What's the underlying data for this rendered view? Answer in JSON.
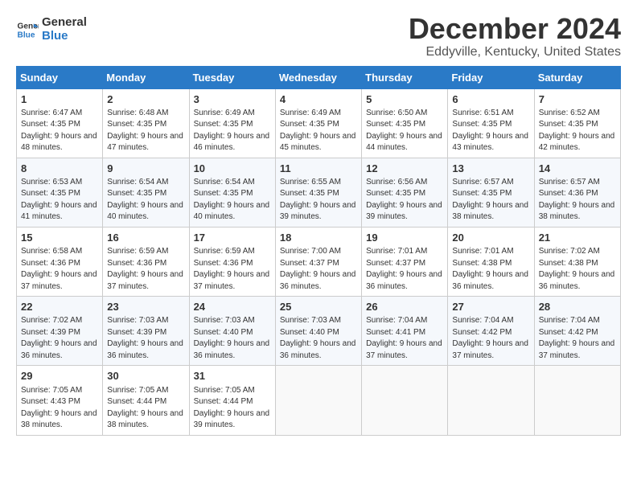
{
  "header": {
    "logo_line1": "General",
    "logo_line2": "Blue",
    "month": "December 2024",
    "location": "Eddyville, Kentucky, United States"
  },
  "weekdays": [
    "Sunday",
    "Monday",
    "Tuesday",
    "Wednesday",
    "Thursday",
    "Friday",
    "Saturday"
  ],
  "weeks": [
    [
      {
        "day": "1",
        "sunrise": "6:47 AM",
        "sunset": "4:35 PM",
        "daylight": "9 hours and 48 minutes."
      },
      {
        "day": "2",
        "sunrise": "6:48 AM",
        "sunset": "4:35 PM",
        "daylight": "9 hours and 47 minutes."
      },
      {
        "day": "3",
        "sunrise": "6:49 AM",
        "sunset": "4:35 PM",
        "daylight": "9 hours and 46 minutes."
      },
      {
        "day": "4",
        "sunrise": "6:49 AM",
        "sunset": "4:35 PM",
        "daylight": "9 hours and 45 minutes."
      },
      {
        "day": "5",
        "sunrise": "6:50 AM",
        "sunset": "4:35 PM",
        "daylight": "9 hours and 44 minutes."
      },
      {
        "day": "6",
        "sunrise": "6:51 AM",
        "sunset": "4:35 PM",
        "daylight": "9 hours and 43 minutes."
      },
      {
        "day": "7",
        "sunrise": "6:52 AM",
        "sunset": "4:35 PM",
        "daylight": "9 hours and 42 minutes."
      }
    ],
    [
      {
        "day": "8",
        "sunrise": "6:53 AM",
        "sunset": "4:35 PM",
        "daylight": "9 hours and 41 minutes."
      },
      {
        "day": "9",
        "sunrise": "6:54 AM",
        "sunset": "4:35 PM",
        "daylight": "9 hours and 40 minutes."
      },
      {
        "day": "10",
        "sunrise": "6:54 AM",
        "sunset": "4:35 PM",
        "daylight": "9 hours and 40 minutes."
      },
      {
        "day": "11",
        "sunrise": "6:55 AM",
        "sunset": "4:35 PM",
        "daylight": "9 hours and 39 minutes."
      },
      {
        "day": "12",
        "sunrise": "6:56 AM",
        "sunset": "4:35 PM",
        "daylight": "9 hours and 39 minutes."
      },
      {
        "day": "13",
        "sunrise": "6:57 AM",
        "sunset": "4:35 PM",
        "daylight": "9 hours and 38 minutes."
      },
      {
        "day": "14",
        "sunrise": "6:57 AM",
        "sunset": "4:36 PM",
        "daylight": "9 hours and 38 minutes."
      }
    ],
    [
      {
        "day": "15",
        "sunrise": "6:58 AM",
        "sunset": "4:36 PM",
        "daylight": "9 hours and 37 minutes."
      },
      {
        "day": "16",
        "sunrise": "6:59 AM",
        "sunset": "4:36 PM",
        "daylight": "9 hours and 37 minutes."
      },
      {
        "day": "17",
        "sunrise": "6:59 AM",
        "sunset": "4:36 PM",
        "daylight": "9 hours and 37 minutes."
      },
      {
        "day": "18",
        "sunrise": "7:00 AM",
        "sunset": "4:37 PM",
        "daylight": "9 hours and 36 minutes."
      },
      {
        "day": "19",
        "sunrise": "7:01 AM",
        "sunset": "4:37 PM",
        "daylight": "9 hours and 36 minutes."
      },
      {
        "day": "20",
        "sunrise": "7:01 AM",
        "sunset": "4:38 PM",
        "daylight": "9 hours and 36 minutes."
      },
      {
        "day": "21",
        "sunrise": "7:02 AM",
        "sunset": "4:38 PM",
        "daylight": "9 hours and 36 minutes."
      }
    ],
    [
      {
        "day": "22",
        "sunrise": "7:02 AM",
        "sunset": "4:39 PM",
        "daylight": "9 hours and 36 minutes."
      },
      {
        "day": "23",
        "sunrise": "7:03 AM",
        "sunset": "4:39 PM",
        "daylight": "9 hours and 36 minutes."
      },
      {
        "day": "24",
        "sunrise": "7:03 AM",
        "sunset": "4:40 PM",
        "daylight": "9 hours and 36 minutes."
      },
      {
        "day": "25",
        "sunrise": "7:03 AM",
        "sunset": "4:40 PM",
        "daylight": "9 hours and 36 minutes."
      },
      {
        "day": "26",
        "sunrise": "7:04 AM",
        "sunset": "4:41 PM",
        "daylight": "9 hours and 37 minutes."
      },
      {
        "day": "27",
        "sunrise": "7:04 AM",
        "sunset": "4:42 PM",
        "daylight": "9 hours and 37 minutes."
      },
      {
        "day": "28",
        "sunrise": "7:04 AM",
        "sunset": "4:42 PM",
        "daylight": "9 hours and 37 minutes."
      }
    ],
    [
      {
        "day": "29",
        "sunrise": "7:05 AM",
        "sunset": "4:43 PM",
        "daylight": "9 hours and 38 minutes."
      },
      {
        "day": "30",
        "sunrise": "7:05 AM",
        "sunset": "4:44 PM",
        "daylight": "9 hours and 38 minutes."
      },
      {
        "day": "31",
        "sunrise": "7:05 AM",
        "sunset": "4:44 PM",
        "daylight": "9 hours and 39 minutes."
      },
      null,
      null,
      null,
      null
    ]
  ]
}
